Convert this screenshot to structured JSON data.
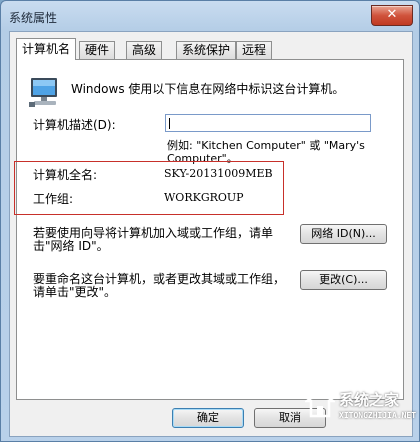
{
  "window": {
    "title": "系统属性",
    "close_label": "✕"
  },
  "tabs": [
    {
      "label": "计算机名",
      "active": true
    },
    {
      "label": "硬件",
      "active": false
    },
    {
      "label": "高级",
      "active": false
    },
    {
      "label": "系统保护",
      "active": false
    },
    {
      "label": "远程",
      "active": false
    }
  ],
  "intro_text": "Windows 使用以下信息在网络中标识这台计算机。",
  "description": {
    "label": "计算机描述(D):",
    "value": "",
    "example_line1": "例如: \"Kitchen Computer\" 或 \"Mary's",
    "example_line2": "Computer\"。"
  },
  "full_name": {
    "label": "计算机全名:",
    "value": "SKY-20131009MEB"
  },
  "workgroup": {
    "label": "工作组:",
    "value": "WORKGROUP"
  },
  "network_id": {
    "text_line1": "若要使用向导将计算机加入域或工作组，请单",
    "text_line2": "击\"网络 ID\"。",
    "button_label": "网络 ID(N)..."
  },
  "rename": {
    "text_line1": "要重命名这台计算机，或者更改其域或工作组，",
    "text_line2": "请单击\"更改\"。",
    "button_label": "更改(C)..."
  },
  "footer": {
    "ok_label": "确定",
    "cancel_label": "取消"
  },
  "watermark": {
    "text": "系统之家",
    "url": "XITONGZHIJIA.NET"
  },
  "icons": {
    "computer": "monitor-icon"
  },
  "colors": {
    "highlight_border": "#c7302a",
    "title_bar": "#c9dcf0",
    "close_button": "#d0533c"
  }
}
